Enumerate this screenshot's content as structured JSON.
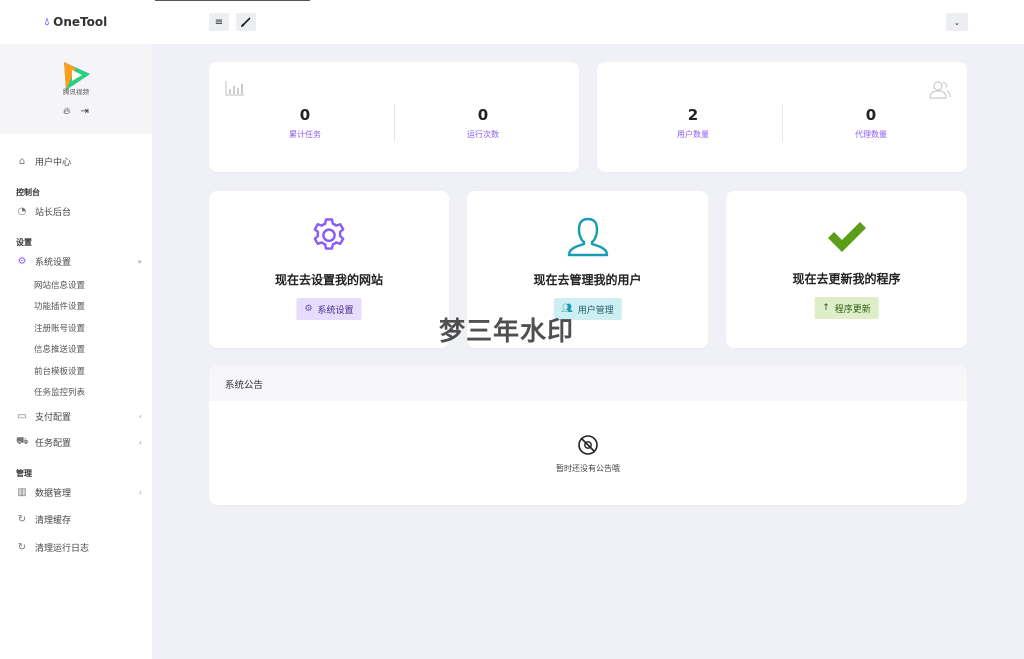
{
  "brand": {
    "name": "OneTool"
  },
  "profile": {
    "avatar_caption": "腾讯视频"
  },
  "nav": {
    "user_center": "用户中心",
    "section_console": "控制台",
    "dashboard": "站长后台",
    "section_settings": "设置",
    "system_settings": "系统设置",
    "system_settings_children": [
      "网站信息设置",
      "功能插件设置",
      "注册账号设置",
      "信息推送设置",
      "前台模板设置",
      "任务监控列表"
    ],
    "payment_config": "支付配置",
    "task_config": "任务配置",
    "section_manage": "管理",
    "data_manage": "数据管理",
    "clear_cache": "清理缓存",
    "clear_logs": "清理运行日志"
  },
  "stats_left": [
    {
      "value": "0",
      "label": "累计任务"
    },
    {
      "value": "0",
      "label": "运行次数"
    }
  ],
  "stats_right": [
    {
      "value": "2",
      "label": "用户数量"
    },
    {
      "value": "0",
      "label": "代理数量"
    }
  ],
  "actions": [
    {
      "title": "现在去设置我的网站",
      "button": "系统设置",
      "icon": "gear-icon",
      "color": "#8b5cf6"
    },
    {
      "title": "现在去管理我的用户",
      "button": "用户管理",
      "icon": "user-icon",
      "color": "#1a9cb0"
    },
    {
      "title": "现在去更新我的程序",
      "button": "程序更新",
      "icon": "check-icon",
      "color": "#5a9e1a"
    }
  ],
  "watermark": "梦三年水印",
  "notice": {
    "title": "系统公告",
    "empty_text": "暂时还没有公告哦"
  }
}
